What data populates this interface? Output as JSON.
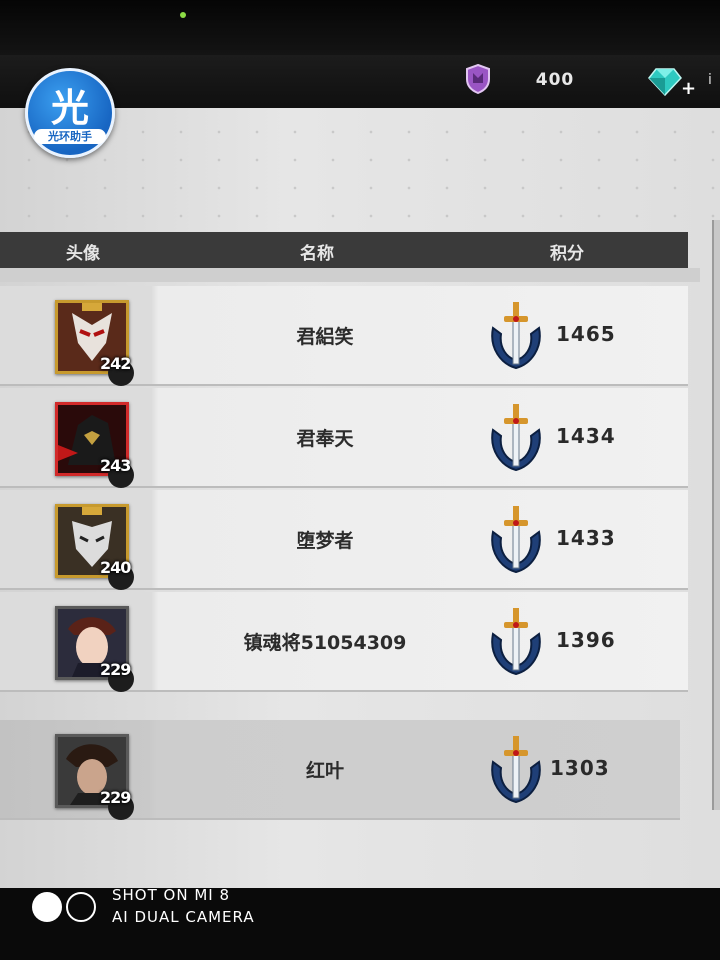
{
  "app": {
    "logo_char": "光",
    "logo_text": "光环助手"
  },
  "resources": {
    "shield_value": "400",
    "gem_icon": "gem-icon",
    "plus": "+",
    "edge_text": "i"
  },
  "table": {
    "headers": {
      "avatar": "头像",
      "name": "名称",
      "score": "积分"
    },
    "rows": [
      {
        "name": "君絽笑",
        "level": "242",
        "score": "1465",
        "frame": "gold"
      },
      {
        "name": "君奉天",
        "level": "243",
        "score": "1434",
        "frame": "red"
      },
      {
        "name": "堕梦者",
        "level": "240",
        "score": "1433",
        "frame": "gold"
      },
      {
        "name": "镇魂将51054309",
        "level": "229",
        "score": "1396",
        "frame": "plain"
      },
      {
        "name": "红叶",
        "level": "229",
        "score": "1303",
        "frame": "plain"
      }
    ]
  },
  "watermark": {
    "line1": "SHOT ON MI 8",
    "line2": "AI DUAL CAMERA"
  },
  "colors": {
    "header_bg": "#3a3a3a",
    "gold_frame": "#c79a2e",
    "sword_blue": "#1f3f77"
  }
}
